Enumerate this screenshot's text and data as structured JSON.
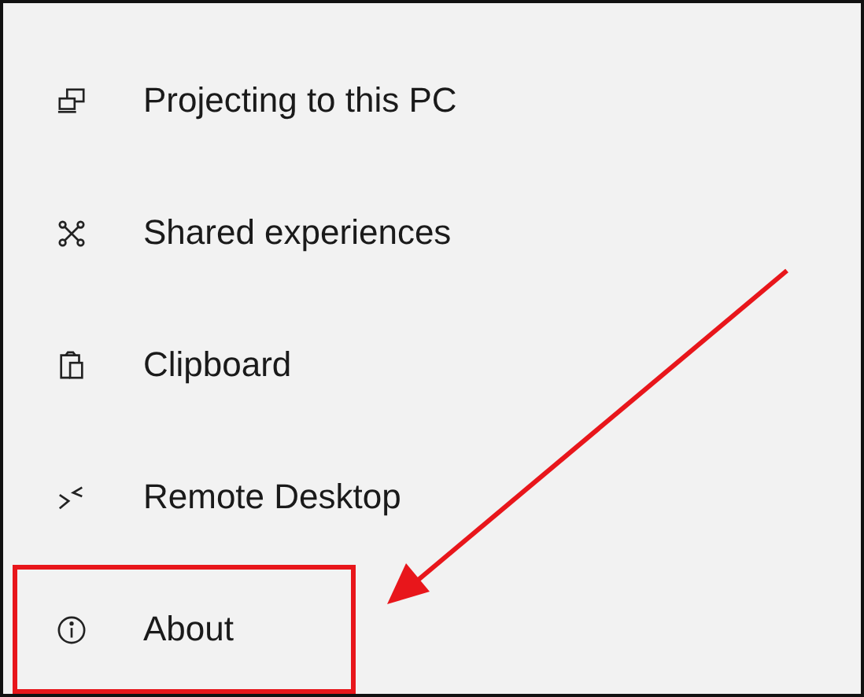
{
  "menu": {
    "items": [
      {
        "kind": "projecting",
        "label": "Projecting to this PC",
        "highlighted": false
      },
      {
        "kind": "shared",
        "label": "Shared experiences",
        "highlighted": false
      },
      {
        "kind": "clipboard",
        "label": "Clipboard",
        "highlighted": false
      },
      {
        "kind": "remote",
        "label": "Remote Desktop",
        "highlighted": false
      },
      {
        "kind": "about",
        "label": "About",
        "highlighted": true
      }
    ]
  }
}
